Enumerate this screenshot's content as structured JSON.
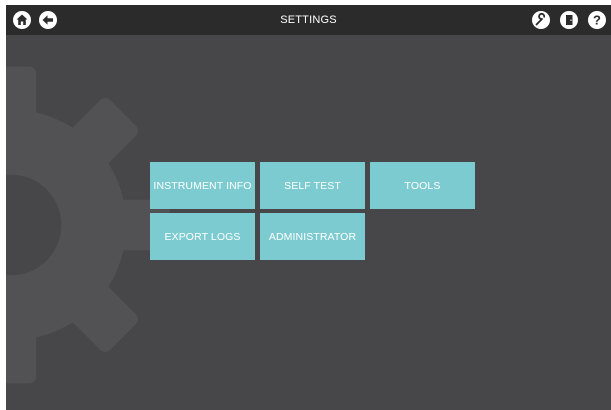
{
  "header": {
    "title": "SETTINGS",
    "left_icons": [
      "home-icon",
      "back-icon"
    ],
    "right_icons": [
      "service-icon",
      "exit-icon",
      "help-icon"
    ]
  },
  "menu": {
    "items": [
      {
        "label": "INSTRUMENT INFO"
      },
      {
        "label": "SELF TEST"
      },
      {
        "label": "TOOLS"
      },
      {
        "label": "EXPORT LOGS"
      },
      {
        "label": "ADMINISTRATOR"
      }
    ]
  },
  "colors": {
    "background": "#474749",
    "topbar": "#2b2b2c",
    "tile": "#7ccbd1",
    "text": "#ffffff"
  }
}
